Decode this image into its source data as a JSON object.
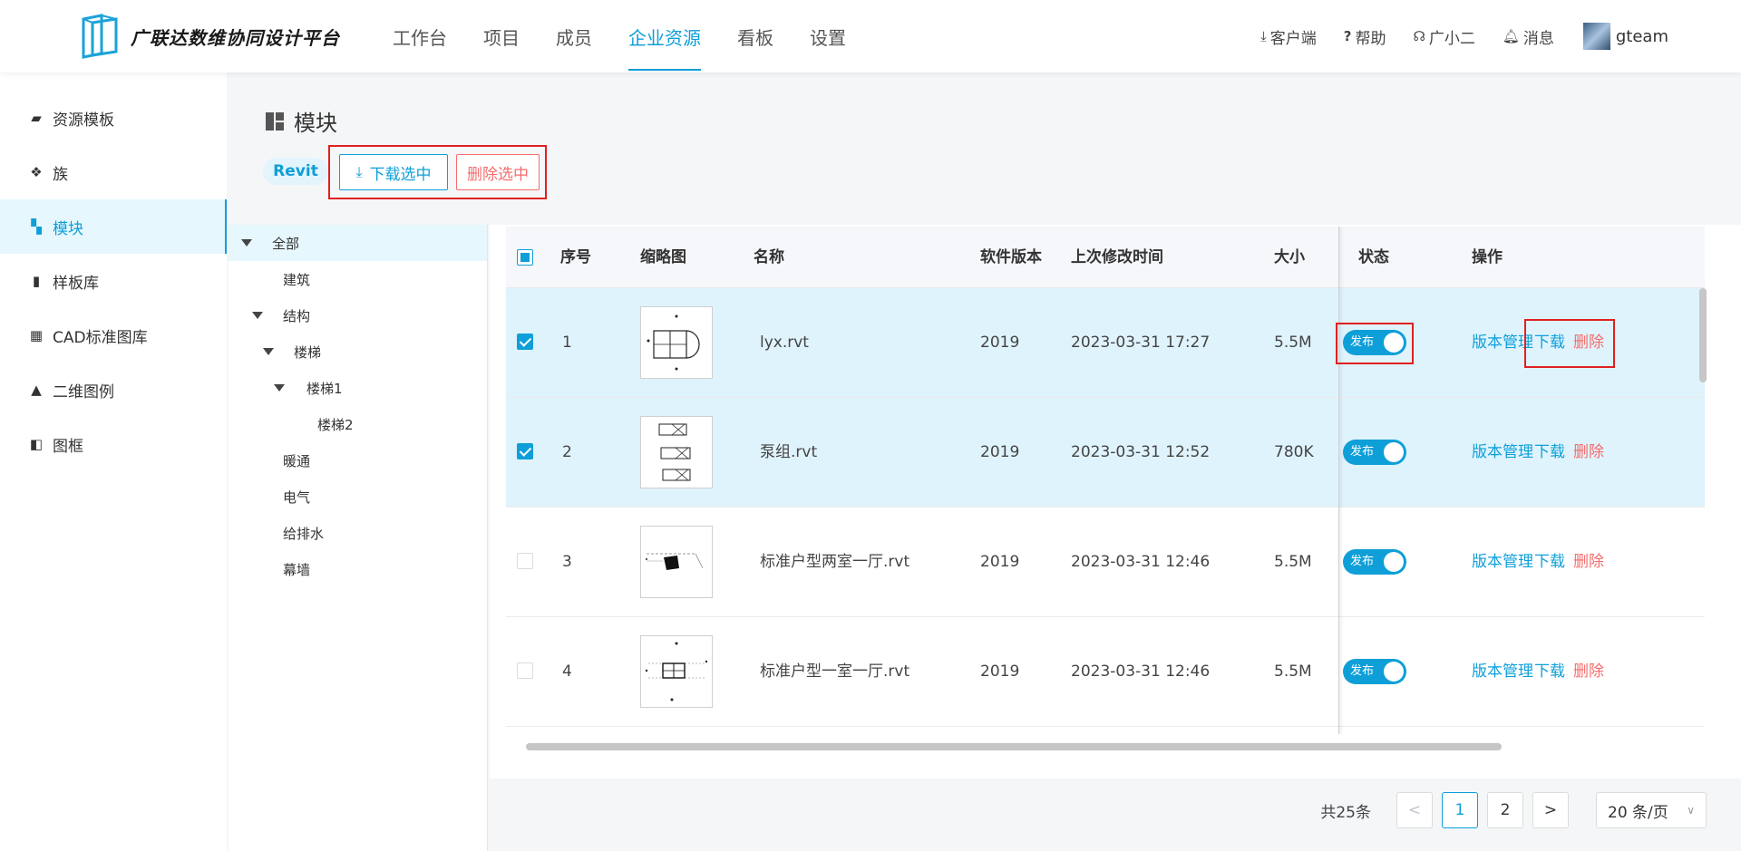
{
  "app": {
    "title": "广联达数维协同设计平台",
    "logo_icon": "logo-icon",
    "accent_color": "#0e9fd8",
    "danger_color": "#f56c6c"
  },
  "nav": [
    {
      "label": "工作台",
      "active": false
    },
    {
      "label": "项目",
      "active": false
    },
    {
      "label": "成员",
      "active": false
    },
    {
      "label": "企业资源",
      "active": true
    },
    {
      "label": "看板",
      "active": false
    },
    {
      "label": "设置",
      "active": false
    }
  ],
  "header_links": [
    {
      "label": "客户端",
      "icon": "download-icon"
    },
    {
      "label": "帮助",
      "icon": "question-icon"
    },
    {
      "label": "广小二",
      "icon": "headset-icon"
    },
    {
      "label": "消息",
      "icon": "bell-icon"
    }
  ],
  "user": {
    "name": "gteam"
  },
  "sidebar": [
    {
      "label": "资源模板",
      "icon": "template-icon",
      "active": false
    },
    {
      "label": "族",
      "icon": "family-icon",
      "active": false
    },
    {
      "label": "模块",
      "icon": "module-icon",
      "active": true
    },
    {
      "label": "样板库",
      "icon": "sample-library-icon",
      "active": false
    },
    {
      "label": "CAD标准图库",
      "icon": "cad-library-icon",
      "active": false
    },
    {
      "label": "二维图例",
      "icon": "legend-icon",
      "active": false
    },
    {
      "label": "图框",
      "icon": "frame-icon",
      "active": false
    }
  ],
  "page": {
    "title": "模块",
    "tag": "Revit",
    "download_selected": "下载选中",
    "delete_selected": "删除选中"
  },
  "tree": [
    {
      "label": "全部",
      "level": 0,
      "expanded": true,
      "has_children": true,
      "active": true
    },
    {
      "label": "建筑",
      "level": 1,
      "has_children": false
    },
    {
      "label": "结构",
      "level": 1,
      "expanded": true,
      "has_children": true
    },
    {
      "label": "楼梯",
      "level": 2,
      "expanded": true,
      "has_children": true
    },
    {
      "label": "楼梯1",
      "level": 3,
      "expanded": true,
      "has_children": true
    },
    {
      "label": "楼梯2",
      "level": 4,
      "has_children": false
    },
    {
      "label": "暖通",
      "level": 1,
      "has_children": false
    },
    {
      "label": "电气",
      "level": 1,
      "has_children": false
    },
    {
      "label": "给排水",
      "level": 1,
      "has_children": false
    },
    {
      "label": "幕墙",
      "level": 1,
      "has_children": false
    }
  ],
  "table": {
    "columns": {
      "index": "序号",
      "thumb": "缩略图",
      "name": "名称",
      "version": "软件版本",
      "modified": "上次修改时间",
      "size": "大小",
      "status": "状态",
      "actions": "操作"
    },
    "header_checkbox": "partial",
    "rows": [
      {
        "checked": true,
        "index": "1",
        "thumb": "thumb-door-plan",
        "name": "lyx.rvt",
        "version": "2019",
        "modified": "2023-03-31 17:27",
        "size": "5.5M",
        "status": "发布",
        "act_version": "版本管理",
        "act_download": "下载",
        "act_delete": "删除"
      },
      {
        "checked": true,
        "index": "2",
        "thumb": "thumb-pump-group",
        "name": "泵组.rvt",
        "version": "2019",
        "modified": "2023-03-31 12:52",
        "size": "780K",
        "status": "发布",
        "act_version": "版本管理",
        "act_download": "下载",
        "act_delete": "删除"
      },
      {
        "checked": false,
        "index": "3",
        "thumb": "thumb-two-room",
        "name": "标准户型两室一厅.rvt",
        "version": "2019",
        "modified": "2023-03-31 12:46",
        "size": "5.5M",
        "status": "发布",
        "act_version": "版本管理",
        "act_download": "下载",
        "act_delete": "删除"
      },
      {
        "checked": false,
        "index": "4",
        "thumb": "thumb-one-room",
        "name": "标准户型一室一厅.rvt",
        "version": "2019",
        "modified": "2023-03-31 12:46",
        "size": "5.5M",
        "status": "发布",
        "act_version": "版本管理",
        "act_download": "下载",
        "act_delete": "删除"
      }
    ]
  },
  "pagination": {
    "total": "共25条",
    "prev": "<",
    "pages": [
      "1",
      "2"
    ],
    "current": "1",
    "next": ">",
    "page_size": "20 条/页"
  }
}
